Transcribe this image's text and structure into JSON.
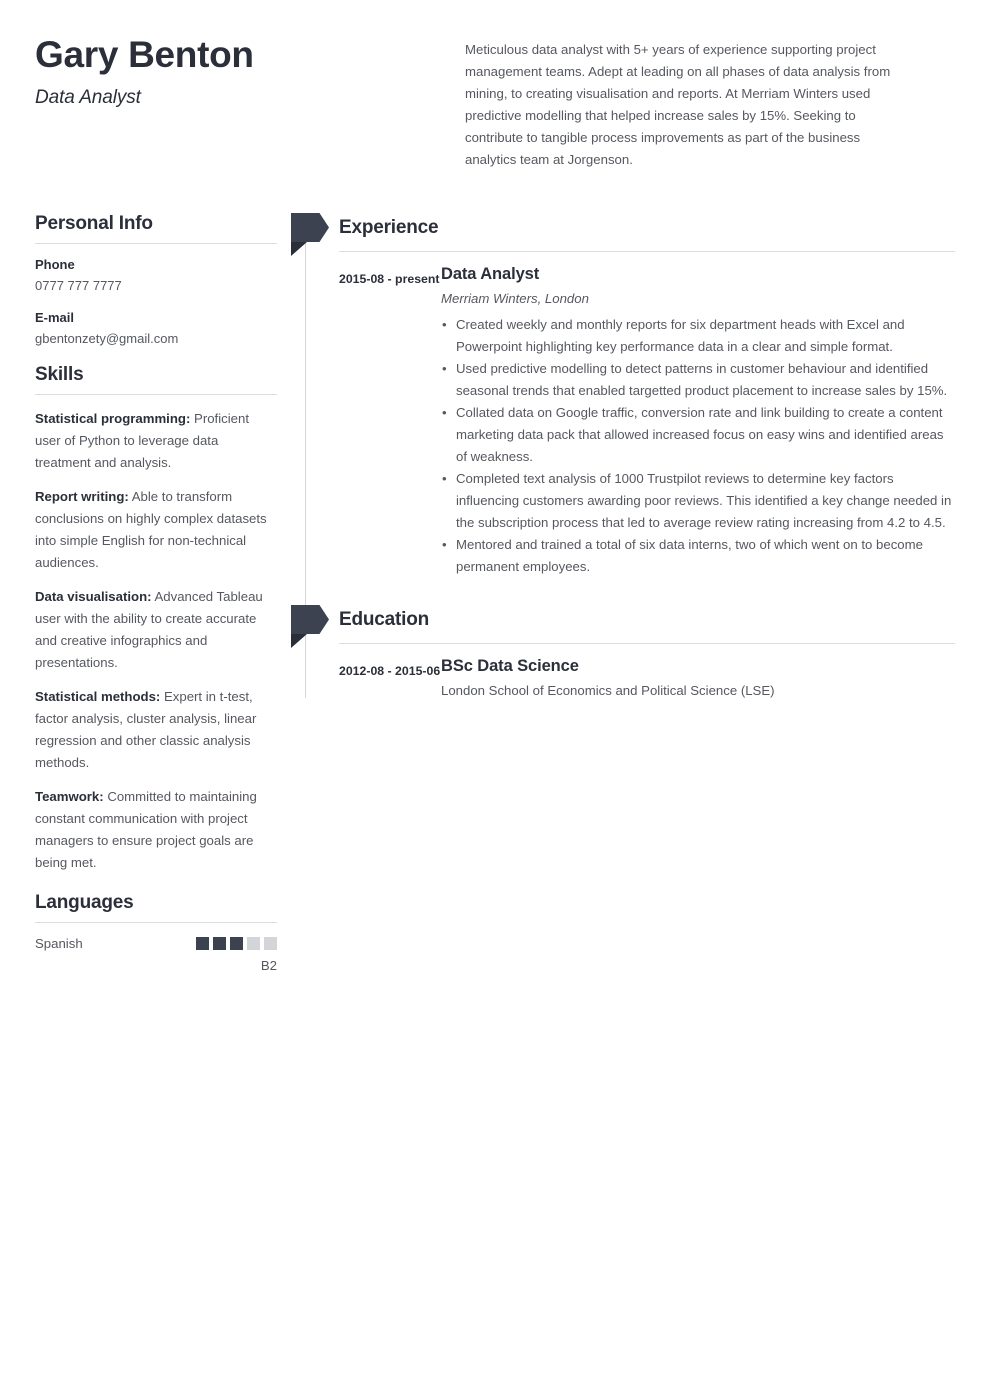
{
  "header": {
    "full_name": "Gary Benton",
    "job_title": "Data Analyst",
    "summary": "Meticulous data analyst with 5+ years of experience supporting project management teams. Adept at leading on all phases of data analysis from mining, to creating visualisation and reports. At Merriam Winters used predictive modelling that helped increase sales by 15%. Seeking to contribute to tangible process improvements as part of the business analytics team at Jorgenson."
  },
  "sidebar": {
    "personal_info": {
      "heading": "Personal Info",
      "items": [
        {
          "label": "Phone",
          "value": "0777 777 7777"
        },
        {
          "label": "E-mail",
          "value": "gbentonzety@gmail.com"
        }
      ]
    },
    "skills": {
      "heading": "Skills",
      "items": [
        {
          "name": "Statistical programming:",
          "description": " Proficient user of Python to leverage data treatment and analysis."
        },
        {
          "name": "Report writing:",
          "description": " Able to transform conclusions on highly complex datasets into simple English for non-technical audiences."
        },
        {
          "name": "Data visualisation:",
          "description": " Advanced Tableau user with the ability to create accurate and creative infographics and presentations."
        },
        {
          "name": "Statistical methods:",
          "description": " Expert in t-test, factor analysis, cluster analysis, linear regression and other classic analysis methods."
        },
        {
          "name": "Teamwork:",
          "description": " Committed to maintaining constant communication with project managers to ensure project goals are being met."
        }
      ]
    },
    "languages": {
      "heading": "Languages",
      "items": [
        {
          "name": "Spanish",
          "rating": 3,
          "max_rating": 5,
          "level": "B2"
        }
      ]
    }
  },
  "main": {
    "experience": {
      "heading": "Experience",
      "entries": [
        {
          "date": "2015-08 - present",
          "title": "Data Analyst",
          "subtitle": "Merriam Winters, London",
          "bullets": [
            "Created weekly and monthly reports for six department heads with Excel and Powerpoint highlighting key performance data in a clear and simple format.",
            "Used predictive modelling to detect patterns in customer behaviour and identified seasonal trends that enabled targetted product placement to increase sales by 15%.",
            "Collated data on Google traffic, conversion rate and link building to create a content marketing data pack that allowed increased focus on easy wins and identified areas of weakness.",
            "Completed text analysis of 1000 Trustpilot reviews to determine key factors influencing customers awarding poor reviews. This identified a key change needed in the subscription process that led to average review rating increasing from 4.2 to 4.5.",
            "Mentored and trained a total of six data interns, two of which went on to become permanent employees."
          ]
        }
      ]
    },
    "education": {
      "heading": "Education",
      "entries": [
        {
          "date": "2012-08 - 2015-06",
          "title": "BSc Data Science",
          "subtitle": "London School of Economics and Political Science (LSE)"
        }
      ]
    }
  },
  "colors": {
    "heading": "#2b2f3a",
    "body": "#55585f",
    "accent": "#3c4250",
    "accent_dark": "#2a2e39",
    "rule": "#dcdde0",
    "dot_off": "#d3d5d8"
  }
}
